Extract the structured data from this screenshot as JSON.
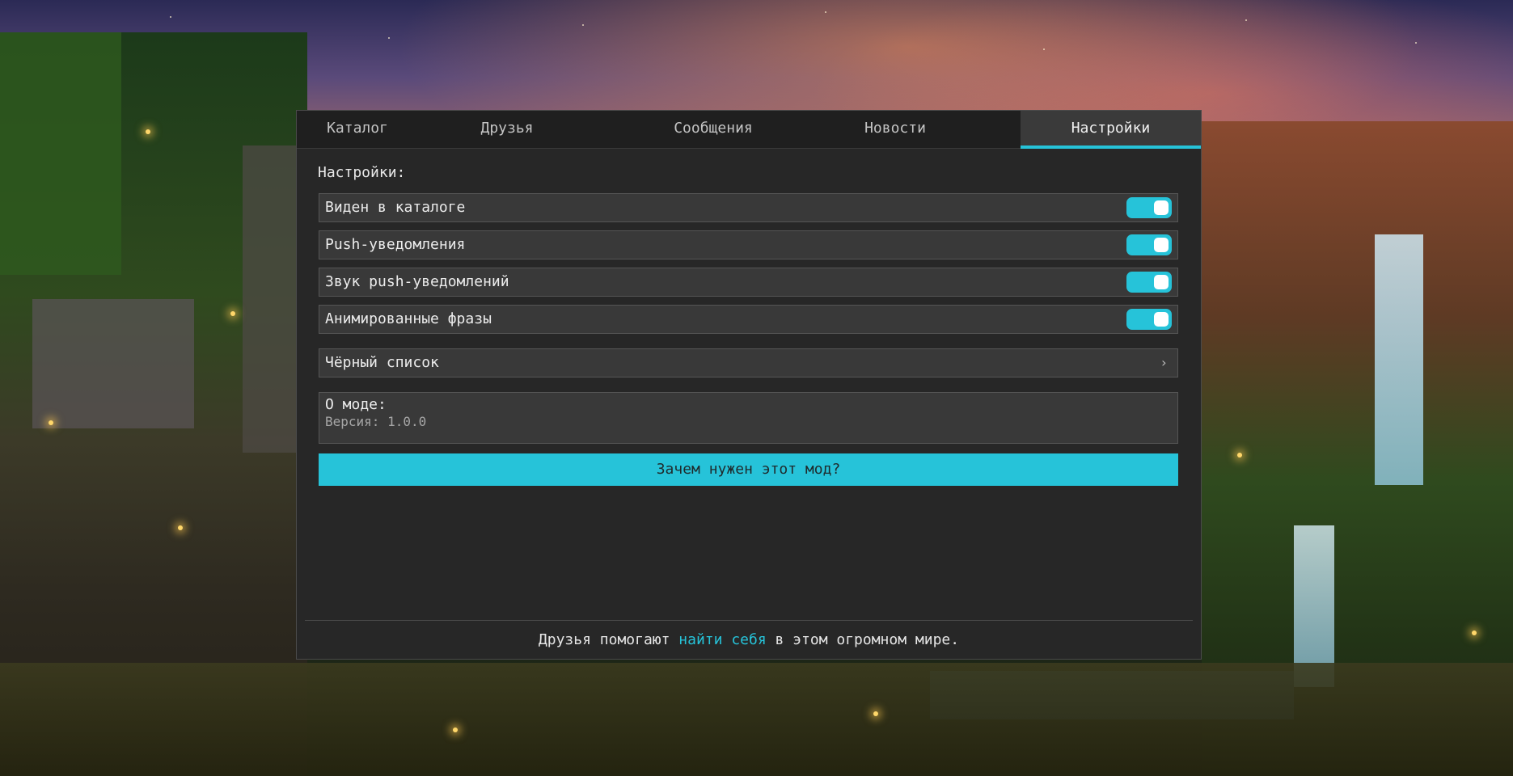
{
  "tabs": [
    {
      "label": "Каталог"
    },
    {
      "label": "Друзья"
    },
    {
      "label": "Сообщения"
    },
    {
      "label": "Новости"
    },
    {
      "label": "Настройки",
      "active": true
    }
  ],
  "settings": {
    "title": "Настройки:",
    "toggles": [
      {
        "label": "Виден в каталоге",
        "on": true
      },
      {
        "label": "Push-уведомления",
        "on": true
      },
      {
        "label": "Звук push-уведомлений",
        "on": true
      },
      {
        "label": "Анимированные фразы",
        "on": true
      }
    ],
    "blacklist_label": "Чёрный список",
    "chevron": "›"
  },
  "about": {
    "title": "О моде:",
    "version": "Версия: 1.0.0"
  },
  "cta": {
    "label": "Зачем нужен этот мод?"
  },
  "footer": {
    "text_before": "Друзья помогают ",
    "link": "найти себя",
    "text_after": " в этом огромном мире."
  },
  "colors": {
    "accent": "#26c3d9",
    "panel_bg": "#272727",
    "row_bg": "#393939"
  }
}
